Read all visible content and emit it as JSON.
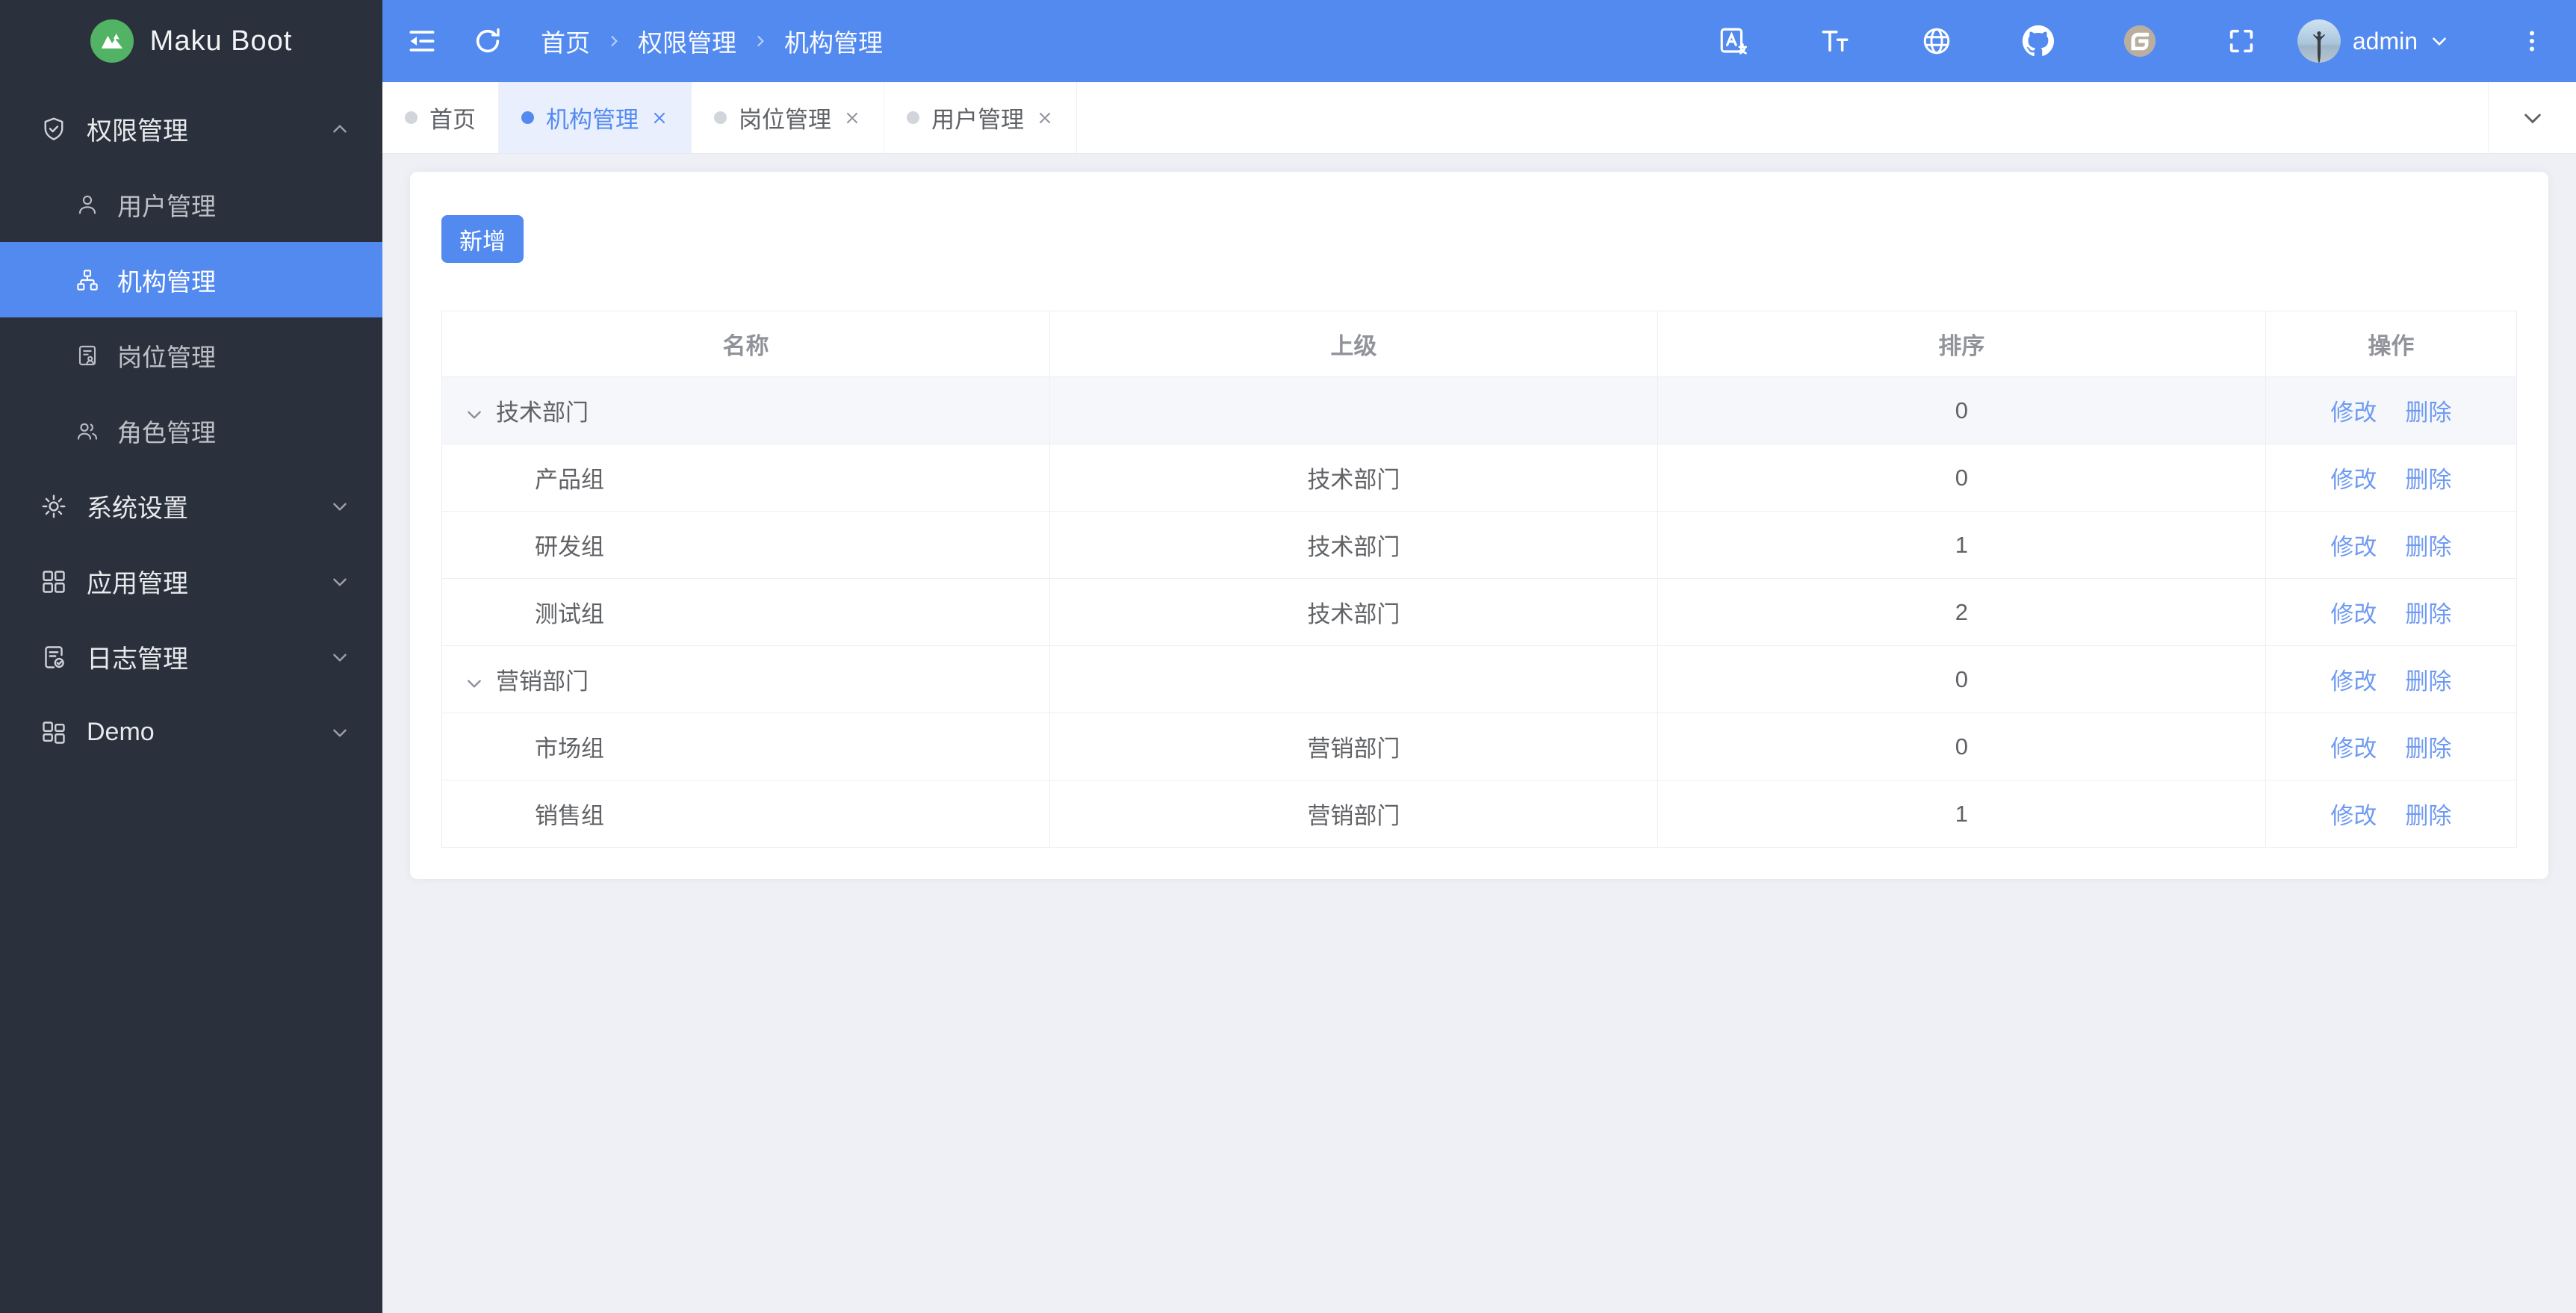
{
  "colors": {
    "primary_blue": "#538af0",
    "sidebar_bg": "#2a313c",
    "active_tab_bg": "#e9effd",
    "content_bg": "#eef0f5",
    "table_border": "#ebeef5",
    "link_blue": "#6f9af2",
    "logo_green": "#53b364",
    "gitee_circle": "#b9ae9f"
  },
  "sidebar": {
    "logo_text": "Maku Boot",
    "logo_icon": "mountain-logo-icon",
    "groups": [
      {
        "label": "权限管理",
        "icon": "shield-check-icon",
        "expanded": true,
        "children": [
          {
            "label": "用户管理",
            "icon": "user-icon",
            "active": false
          },
          {
            "label": "机构管理",
            "icon": "org-chart-icon",
            "active": true
          },
          {
            "label": "岗位管理",
            "icon": "post-badge-icon",
            "active": false
          },
          {
            "label": "角色管理",
            "icon": "roles-icon",
            "active": false
          }
        ]
      },
      {
        "label": "系统设置",
        "icon": "gear-icon",
        "expanded": false,
        "children": []
      },
      {
        "label": "应用管理",
        "icon": "apps-grid-icon",
        "expanded": false,
        "children": []
      },
      {
        "label": "日志管理",
        "icon": "log-check-icon",
        "expanded": false,
        "children": []
      },
      {
        "label": "Demo",
        "icon": "demo-grid-icon",
        "expanded": false,
        "children": []
      }
    ]
  },
  "header": {
    "breadcrumb": [
      "首页",
      "权限管理",
      "机构管理"
    ],
    "left_icons": [
      "menu-fold-icon",
      "refresh-icon"
    ],
    "right_icons": [
      "translate-icon",
      "font-size-icon",
      "globe-icon",
      "github-icon",
      "gitee-icon",
      "fullscreen-icon"
    ],
    "user": "admin"
  },
  "tabs": [
    {
      "label": "首页",
      "active": false,
      "closable": false
    },
    {
      "label": "机构管理",
      "active": true,
      "closable": true
    },
    {
      "label": "岗位管理",
      "active": false,
      "closable": true
    },
    {
      "label": "用户管理",
      "active": false,
      "closable": true
    }
  ],
  "main": {
    "add_button": "新增",
    "table": {
      "columns": [
        "名称",
        "上级",
        "排序",
        "操作"
      ],
      "actions": [
        "修改",
        "删除"
      ],
      "rows": [
        {
          "name": "技术部门",
          "parent": "",
          "sort": "0",
          "level": 0,
          "expandable": true,
          "hovered": true
        },
        {
          "name": "产品组",
          "parent": "技术部门",
          "sort": "0",
          "level": 1,
          "expandable": false,
          "hovered": false
        },
        {
          "name": "研发组",
          "parent": "技术部门",
          "sort": "1",
          "level": 1,
          "expandable": false,
          "hovered": false
        },
        {
          "name": "测试组",
          "parent": "技术部门",
          "sort": "2",
          "level": 1,
          "expandable": false,
          "hovered": false
        },
        {
          "name": "营销部门",
          "parent": "",
          "sort": "0",
          "level": 0,
          "expandable": true,
          "hovered": false
        },
        {
          "name": "市场组",
          "parent": "营销部门",
          "sort": "0",
          "level": 1,
          "expandable": false,
          "hovered": false
        },
        {
          "name": "销售组",
          "parent": "营销部门",
          "sort": "1",
          "level": 1,
          "expandable": false,
          "hovered": false
        }
      ]
    }
  }
}
